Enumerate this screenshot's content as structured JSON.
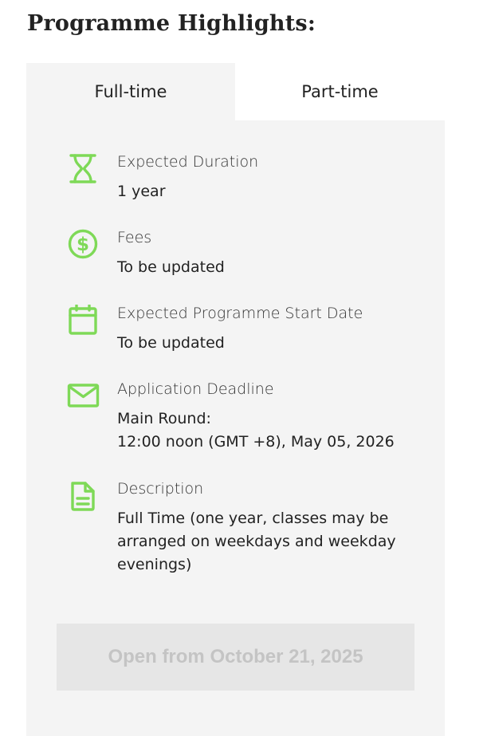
{
  "title": "Programme Highlights:",
  "tabs": [
    {
      "label": "Full-time",
      "active": true
    },
    {
      "label": "Part-time",
      "active": false
    }
  ],
  "accent_color": "#7ed957",
  "items": [
    {
      "icon": "hourglass-icon",
      "label": "Expected Duration",
      "value": [
        "1 year"
      ]
    },
    {
      "icon": "dollar-icon",
      "label": "Fees",
      "value": [
        "To be updated"
      ]
    },
    {
      "icon": "calendar-icon",
      "label": "Expected Programme Start Date",
      "value": [
        "To be updated"
      ]
    },
    {
      "icon": "envelope-icon",
      "label": "Application Deadline",
      "value": [
        "Main Round:",
        "12:00 noon (GMT +8), May 05, 2026"
      ]
    },
    {
      "icon": "document-icon",
      "label": "Description",
      "value": [
        "Full Time (one year, classes may be",
        "arranged on weekdays and weekday",
        "evenings)"
      ]
    }
  ],
  "apply_button": {
    "label": "Open from October 21, 2025",
    "state": "disabled"
  }
}
